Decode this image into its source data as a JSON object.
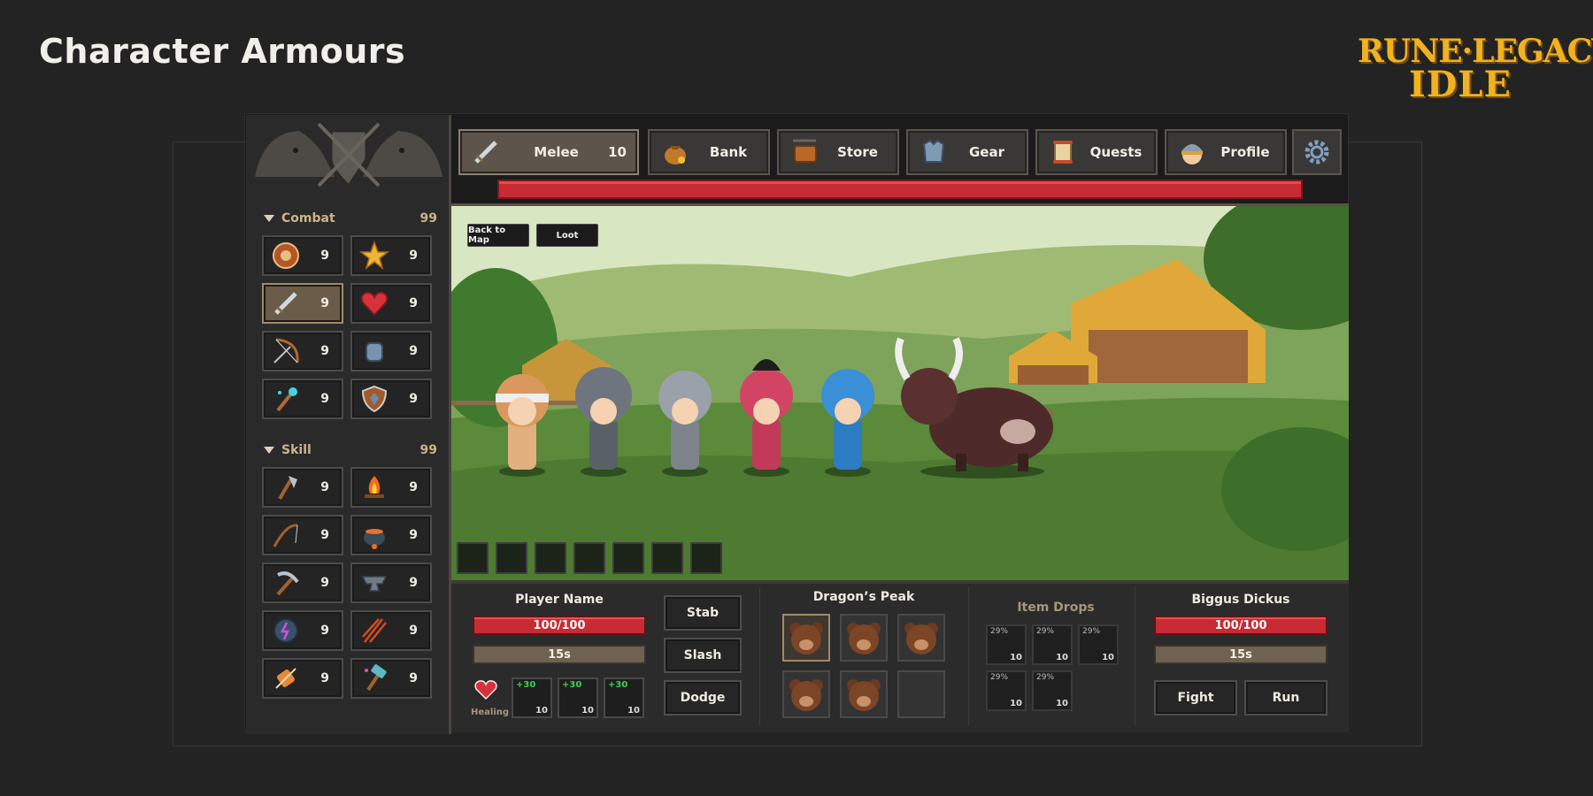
{
  "page_title": "Character Armours",
  "logo": {
    "line1": "RUNE·LEGACY",
    "line2": "IDLE"
  },
  "tabs": [
    {
      "label": "Melee",
      "count": "10",
      "icon": "sword-icon"
    },
    {
      "label": "Bank",
      "icon": "money-bag-icon"
    },
    {
      "label": "Store",
      "icon": "store-sign-icon"
    },
    {
      "label": "Gear",
      "icon": "armor-icon"
    },
    {
      "label": "Quests",
      "icon": "scroll-icon"
    },
    {
      "label": "Profile",
      "icon": "helmet-avatar-icon"
    }
  ],
  "sidebar": {
    "combat": {
      "label": "Combat",
      "total": "99",
      "skills": [
        {
          "icon": "target-shield-icon",
          "level": "9"
        },
        {
          "icon": "star-icon",
          "level": "9"
        },
        {
          "icon": "sword-icon",
          "level": "9"
        },
        {
          "icon": "heart-icon",
          "level": "9"
        },
        {
          "icon": "bow-icon",
          "level": "9"
        },
        {
          "icon": "fist-icon",
          "level": "9"
        },
        {
          "icon": "magic-staff-icon",
          "level": "9"
        },
        {
          "icon": "shield-icon",
          "level": "9"
        }
      ]
    },
    "skill": {
      "label": "Skill",
      "total": "99",
      "skills": [
        {
          "icon": "axe-icon",
          "level": "9"
        },
        {
          "icon": "campfire-icon",
          "level": "9"
        },
        {
          "icon": "fishing-rod-icon",
          "level": "9"
        },
        {
          "icon": "cooking-pot-icon",
          "level": "9"
        },
        {
          "icon": "pickaxe-icon",
          "level": "9"
        },
        {
          "icon": "anvil-icon",
          "level": "9"
        },
        {
          "icon": "rune-stone-icon",
          "level": "9"
        },
        {
          "icon": "arrows-icon",
          "level": "9"
        },
        {
          "icon": "thread-spool-icon",
          "level": "9"
        },
        {
          "icon": "hammer-icon",
          "level": "9"
        }
      ]
    }
  },
  "scene": {
    "back_label": "Back to Map",
    "loot_label": "Loot"
  },
  "player": {
    "name": "Player Name",
    "hp": "100/100",
    "timer": "15s",
    "healing_label": "Healing",
    "heal_slots": [
      {
        "amount": "+30",
        "qty": "10"
      },
      {
        "amount": "+30",
        "qty": "10"
      },
      {
        "amount": "+30",
        "qty": "10"
      }
    ]
  },
  "attacks": [
    "Stab",
    "Slash",
    "Dodge"
  ],
  "location": {
    "name": "Dragon’s Peak"
  },
  "drops": {
    "title": "Item Drops",
    "items": [
      {
        "pct": "29%",
        "qty": "10"
      },
      {
        "pct": "29%",
        "qty": "10"
      },
      {
        "pct": "29%",
        "qty": "10"
      },
      {
        "pct": "29%",
        "qty": "10"
      },
      {
        "pct": "29%",
        "qty": "10"
      }
    ]
  },
  "enemy": {
    "name": "Biggus Dickus",
    "hp": "100/100",
    "timer": "15s"
  },
  "actions": {
    "fight": "Fight",
    "run": "Run"
  },
  "colors": {
    "hp_red": "#c82b33",
    "timer_brown": "#6e6250",
    "logo_gold": "#f0b21e"
  }
}
